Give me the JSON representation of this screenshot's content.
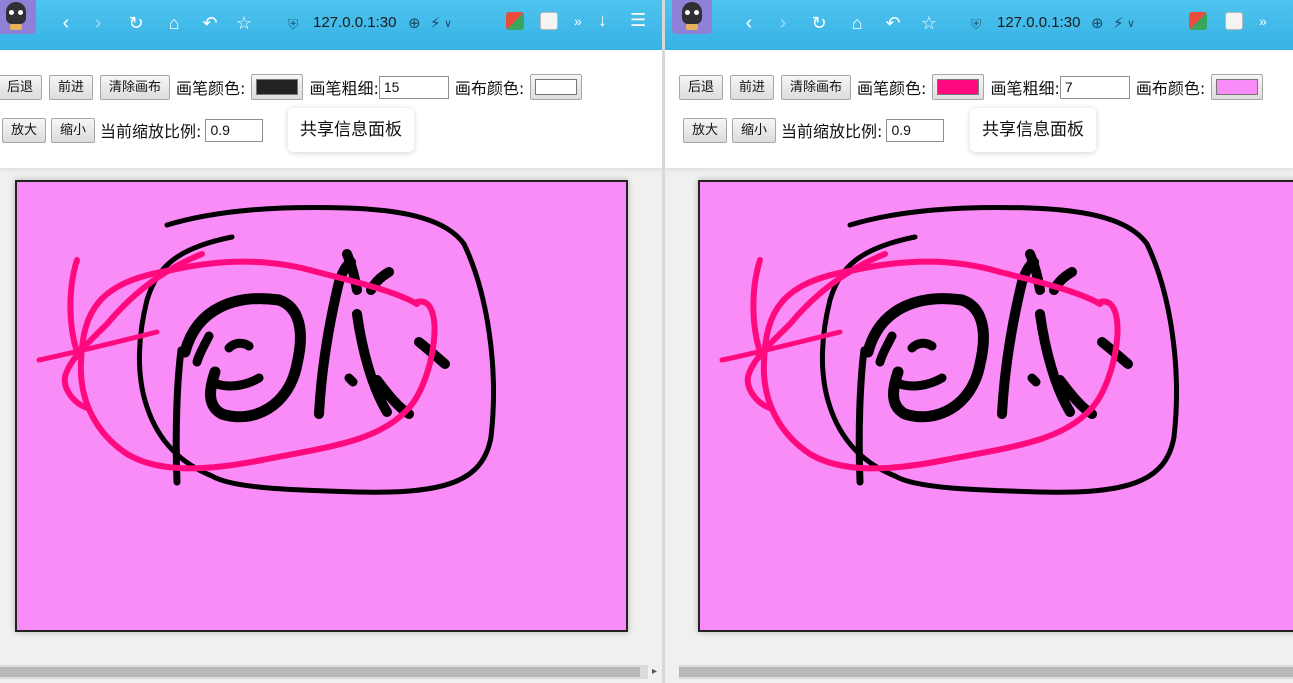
{
  "panes": {
    "left": {
      "url": "127.0.0.1:30",
      "toolbar": {
        "undo": "后退",
        "redo": "前进",
        "clear": "清除画布",
        "pen_color_label": "画笔颜色:",
        "pen_color_value": "#222222",
        "pen_width_label": "画笔粗细:",
        "pen_width_value": "15",
        "canvas_color_label": "画布颜色:",
        "canvas_color_value": "#ffffff",
        "zoom_in": "放大",
        "zoom_out": "缩小",
        "zoom_label": "当前缩放比例:",
        "zoom_value": "0.9",
        "shared_panel": "共享信息面板"
      },
      "canvas_bg": "#f98cf7"
    },
    "right": {
      "url": "127.0.0.1:30",
      "toolbar": {
        "undo": "后退",
        "redo": "前进",
        "clear": "清除画布",
        "pen_color_label": "画笔颜色:",
        "pen_color_value": "#ff0a7e",
        "pen_width_label": "画笔粗细:",
        "pen_width_value": "7",
        "canvas_color_label": "画布颜色:",
        "canvas_color_value": "#f98cf7",
        "zoom_in": "放大",
        "zoom_out": "缩小",
        "zoom_label": "当前缩放比例:",
        "zoom_value": "0.9",
        "shared_panel": "共享信息面板"
      },
      "canvas_bg": "#f98cf7"
    }
  },
  "colors": {
    "browser_bar": "#36b2e6",
    "ink_black": "#000000",
    "ink_pink": "#ff0a7e"
  },
  "icons": [
    "back-icon",
    "forward-icon",
    "reload-icon",
    "home-icon",
    "undo-icon",
    "star-icon",
    "shield-icon",
    "zoom-icon",
    "lightning-icon",
    "extensions-icon",
    "download-icon",
    "menu-icon"
  ]
}
